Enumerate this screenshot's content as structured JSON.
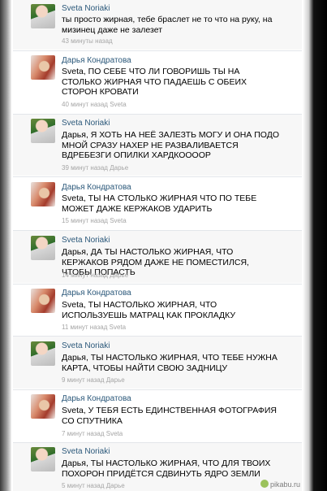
{
  "comments": [
    {
      "author": "Sveta Noriaki",
      "text": "ты просто жирная, тебе браслет не то что на руку, на мизинец даже не залезет",
      "time": "43 минуты назад",
      "reply_to": ""
    },
    {
      "author": "Дарья Кондратова",
      "text": "Sveta, ПО СЕБЕ ЧТО ЛИ ГОВОРИШЬ ТЫ НА СТОЛЬКО ЖИРНАЯ ЧТО ПАДАЕШЬ С ОБЕИХ СТОРОН КРОВАТИ",
      "time": "40 минут назад",
      "reply_to": "Sveta"
    },
    {
      "author": "Sveta Noriaki",
      "text": "Дарья, Я ХОТЬ НА НЕЁ ЗАЛЕЗТЬ МОГУ И ОНА ПОДО МНОЙ СРАЗУ НАХЕР НЕ РАЗВАЛИВАЕТСЯ ВДРЕБЕЗГИ ОПИЛКИ ХАРДКООООР",
      "time": "39 минут назад",
      "reply_to": "Дарье"
    },
    {
      "author": "Дарья Кондратова",
      "text": "Sveta, ТЫ НА СТОЛЬКО ЖИРНАЯ ЧТО ПО ТЕБЕ МОЖЕТ ДАЖЕ КЕРЖАКОВ УДАРИТЬ",
      "time": "15 минут назад",
      "reply_to": "Sveta"
    },
    {
      "author": "Sveta Noriaki",
      "text": "Дарья, ДА ТЫ НАСТОЛЬКО ЖИРНАЯ, ЧТО КЕРЖАКОВ РЯДОМ ДАЖЕ НЕ ПОМЕСТИЛСЯ, ЧТОБЫ ПОПАСТЬ",
      "time": "14 минут назад",
      "reply_to": "Дарье"
    },
    {
      "author": "Дарья Кондратова",
      "text": "Sveta, ТЫ НАСТОЛЬКО ЖИРНАЯ, ЧТО ИСПОЛЬЗУЕШЬ МАТРАЦ КАК ПРОКЛАДКУ",
      "time": "11 минут назад",
      "reply_to": "Sveta"
    },
    {
      "author": "Sveta Noriaki",
      "text": "Дарья, ТЫ НАСТОЛЬКО ЖИРНАЯ, ЧТО ТЕБЕ НУЖНА КАРТА, ЧТОБЫ НАЙТИ СВОЮ ЗАДНИЦУ",
      "time": "9 минут назад",
      "reply_to": "Дарье"
    },
    {
      "author": "Дарья Кондратова",
      "text": "Sveta, У ТЕБЯ ЕСТЬ ЕДИНСТВЕННАЯ ФОТОГРАФИЯ СО СПУТНИКА",
      "time": "7 минут назад",
      "reply_to": "Sveta"
    },
    {
      "author": "Sveta Noriaki",
      "text": "Дарья, ТЫ НАСТОЛЬКО ЖИРНАЯ, ЧТО ДЛЯ ТВОИХ ПОХОРОН ПРИДЁТСЯ СДВИНУТЬ ЯДРО ЗЕМЛИ",
      "time": "5 минут назад",
      "reply_to": "Дарье"
    }
  ],
  "watermark": "pikabu.ru"
}
